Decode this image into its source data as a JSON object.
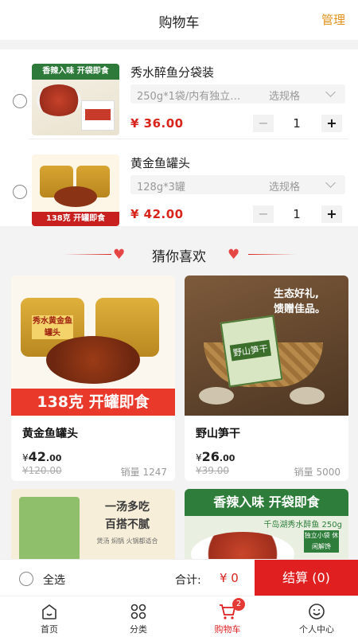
{
  "header": {
    "title": "购物车",
    "manage_label": "管理"
  },
  "cart_items": [
    {
      "name": "秀水醉鱼分袋装",
      "spec": "250g*1袋/内有独立…",
      "spec_choose": "选规格",
      "price": "¥ 36.00",
      "quantity": "1",
      "thumb_text": "香辣入味 开袋即食"
    },
    {
      "name": "黄金鱼罐头",
      "spec": "128g*3罐",
      "spec_choose": "选规格",
      "price": "¥ 42.00",
      "quantity": "1",
      "thumb_text": "138克 开罐即食"
    }
  ],
  "stepper": {
    "minus": "−",
    "plus": "+"
  },
  "recommend": {
    "title": "猜你喜欢"
  },
  "products": [
    {
      "name": "黄金鱼罐头",
      "currency": "¥",
      "price_int": "42",
      "price_dec": ".00",
      "old_price": "¥120.00",
      "sales": "销量 1247",
      "banner": "138克 开罐即食",
      "can_label": "秀水黄金鱼罐头"
    },
    {
      "name": "野山笋干",
      "currency": "¥",
      "price_int": "26",
      "price_dec": ".00",
      "old_price": "¥39.00",
      "sales": "销量 5000",
      "slogan_1": "生态好礼,",
      "slogan_2": "馈赠佳品。",
      "package_label": "野山笋干"
    },
    {
      "slogan_1": "一汤多吃",
      "slogan_2": "百搭不腻",
      "small_text": "煲汤 焖锅 火锅都适合"
    },
    {
      "banner": "香辣入味 开袋即食",
      "sub": "千岛湖秀水醉鱼 250g",
      "tag": "独立小袋 休闲解馋"
    }
  ],
  "checkout": {
    "select_all": "全选",
    "total_label": "合计:",
    "total": "¥ 0",
    "pay_label": "结算 (0)"
  },
  "tabs": [
    {
      "label": "首页",
      "icon": "home-icon"
    },
    {
      "label": "分类",
      "icon": "category-icon"
    },
    {
      "label": "购物车",
      "icon": "cart-icon",
      "badge": "2",
      "active": true
    },
    {
      "label": "个人中心",
      "icon": "profile-icon"
    }
  ],
  "colors": {
    "accent_red": "#df1f20",
    "price_red": "#d8231a",
    "manage_orange": "#e0911c"
  }
}
